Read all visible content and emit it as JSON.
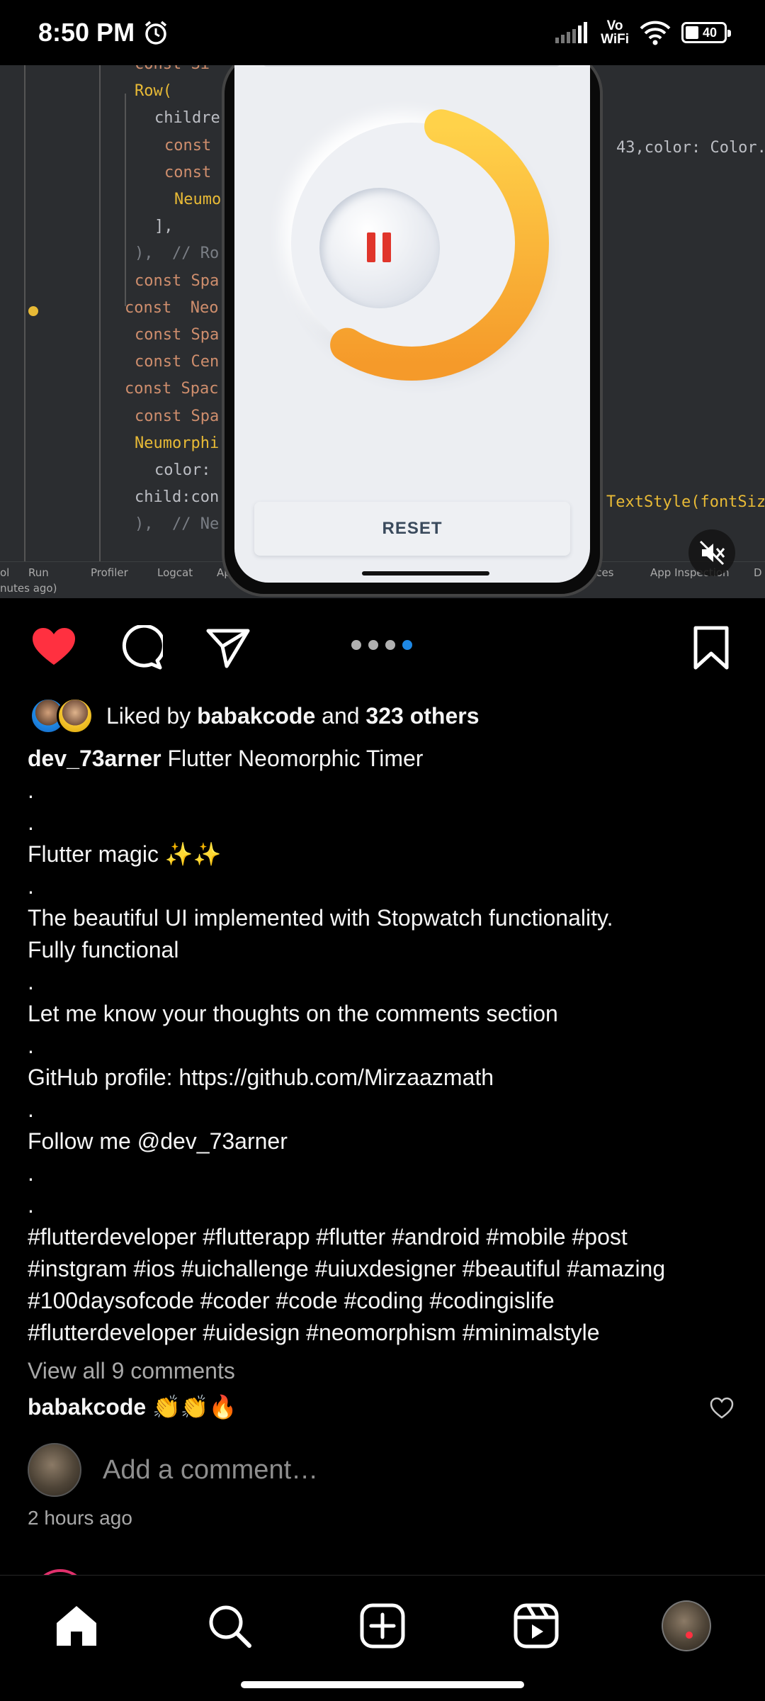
{
  "status_bar": {
    "time": "8:50 PM",
    "network_label_top": "Vo",
    "network_label_bottom": "WiFi",
    "battery_level": "40"
  },
  "media": {
    "code_lines": [
      {
        "text": "const Si",
        "cls": "kw"
      },
      {
        "text": "Row(",
        "cls": "cls"
      },
      {
        "text": "childre",
        "cls": "id"
      },
      {
        "text": "const",
        "cls": "kw"
      },
      {
        "text": "const",
        "cls": "kw"
      },
      {
        "text": "Neumo",
        "cls": "cls"
      },
      {
        "text": "],",
        "cls": "id"
      },
      {
        "text": "),  // Ro",
        "cls": "cm"
      },
      {
        "text": "const Spa",
        "cls": "kw"
      },
      {
        "text": "const  Neo",
        "cls": "kw"
      },
      {
        "text": "const Spa",
        "cls": "kw"
      },
      {
        "text": "const Cen",
        "cls": "kw"
      },
      {
        "text": "const Spac",
        "cls": "kw"
      },
      {
        "text": "const Spa",
        "cls": "kw"
      },
      {
        "text": "Neumorphi",
        "cls": "cls"
      },
      {
        "text": "color:",
        "cls": "id"
      },
      {
        "text": "child:con",
        "cls": "id"
      },
      {
        "text": "),  // Ne",
        "cls": "cm"
      }
    ],
    "code_right_1": "43,color: Color.",
    "code_right_2": "TextStyle(fontSiz",
    "toolbar_items": [
      "ol",
      "Run",
      "Profiler",
      "Logcat",
      "Ap",
      "rvices",
      "App Inspection",
      "D"
    ],
    "toolbar_subtext": "nutes ago)",
    "reset_label": "RESET",
    "timer_progress_fraction": 0.55,
    "colors": {
      "arc_start": "#ffd24a",
      "arc_end": "#f59a2a",
      "pause": "#e0352b"
    }
  },
  "carousel": {
    "count": 4,
    "active_index": 3
  },
  "likes": {
    "prefix": "Liked by ",
    "user": "babakcode",
    "middle": " and ",
    "count": "323 others"
  },
  "caption": {
    "username": "dev_73arner",
    "title": " Flutter Neomorphic Timer",
    "lines": [
      " .",
      ".",
      "Flutter magic ✨✨",
      ".",
      "The beautiful UI implemented with Stopwatch functionality.",
      "Fully functional",
      ".",
      "Let me know your thoughts on the comments section",
      ".",
      "GitHub profile: https://github.com/Mirzaazmath",
      ".",
      "Follow me @dev_73arner",
      ".",
      ".",
      "#flutterdeveloper #flutterapp #flutter #android #mobile #post",
      "#instgram #ios #uichallenge #uiuxdesigner #beautiful #amazing",
      "#100daysofcode #coder #code #coding #codingislife",
      "#flutterdeveloper #uidesign #neomorphism #minimalstyle"
    ]
  },
  "comments": {
    "view_all": "View all 9 comments",
    "top_user": "babakcode",
    "top_text": " 👏👏🔥",
    "add_placeholder": "Add a comment…",
    "time_ago": "2 hours ago"
  },
  "icons": {
    "like": "heart-filled-icon",
    "comment": "comment-bubble-icon",
    "share": "paper-plane-icon",
    "save": "bookmark-icon",
    "mute": "speaker-muted-icon",
    "home": "home-icon",
    "search": "search-icon",
    "create": "plus-square-icon",
    "reels": "reels-icon"
  },
  "colors": {
    "like_red": "#ff3040",
    "carousel_active": "#1e88e5",
    "background": "#000000"
  }
}
